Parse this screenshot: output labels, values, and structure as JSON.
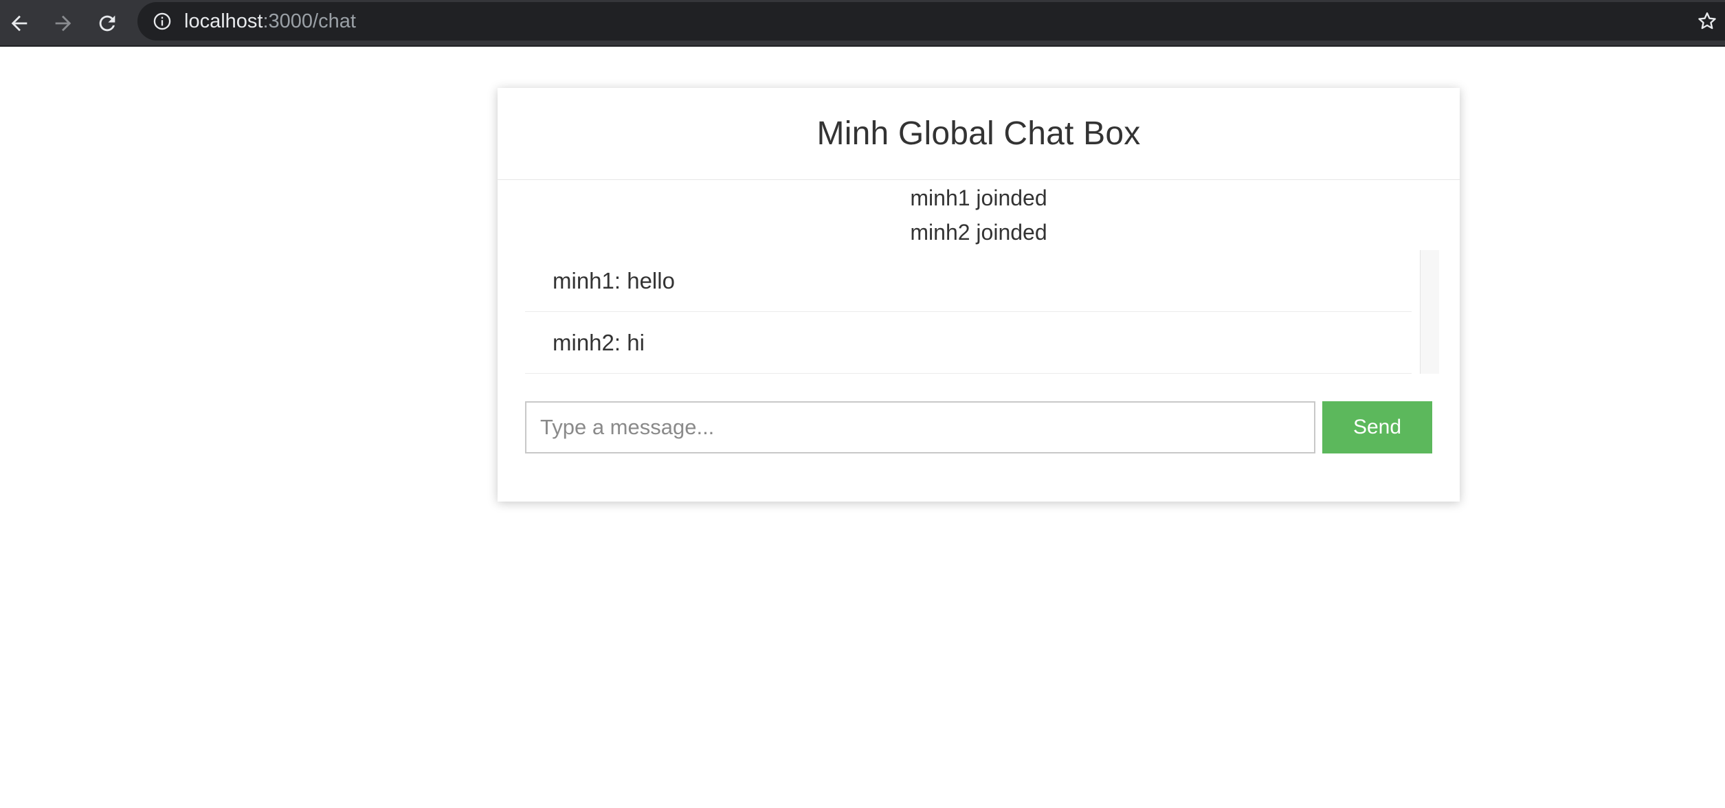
{
  "browser": {
    "url_host": "localhost",
    "url_path": ":3000/chat",
    "icons": {
      "back": "arrow-left-icon",
      "forward": "arrow-right-icon",
      "reload": "reload-icon",
      "info": "info-icon",
      "bookmark": "star-icon"
    }
  },
  "chat": {
    "title": "Minh Global Chat Box",
    "system_messages": [
      "minh1 joinded",
      "minh2 joinded"
    ],
    "messages": [
      "minh1: hello",
      "minh2: hi"
    ],
    "input": {
      "placeholder": "Type a message...",
      "value": ""
    },
    "send_label": "Send"
  },
  "colors": {
    "chrome_background": "#35363a",
    "send_button": "#5cb85c",
    "text": "#333333"
  }
}
